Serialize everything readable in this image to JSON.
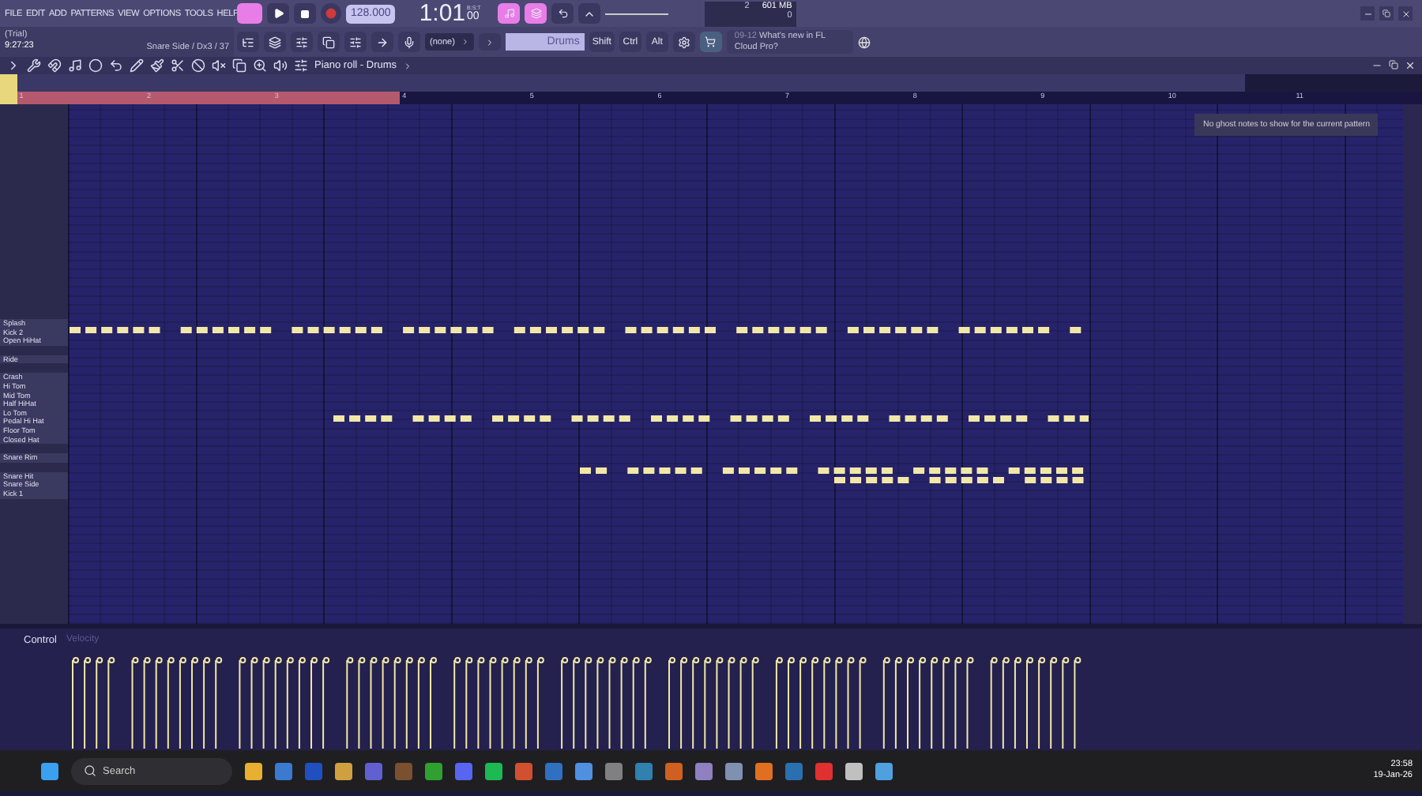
{
  "menu": [
    "FILE",
    "EDIT",
    "ADD",
    "PATTERNS",
    "VIEW",
    "OPTIONS",
    "TOOLS",
    "HELP"
  ],
  "transport": {
    "song_mode": false,
    "tempo": "128.000",
    "time": "1:01",
    "time_small": "00",
    "time_unit": "B:S:T",
    "recording": false
  },
  "monitor": {
    "voices": "2",
    "memory": "601 MB",
    "cpu": "0"
  },
  "hint": {
    "mode": "(Trial)",
    "clock": "9:27:23",
    "status": "Snare Side / Dx3 / 37"
  },
  "target": {
    "value": "(none)"
  },
  "pattern": {
    "value": "Drums"
  },
  "modifiers": [
    {
      "label": "Shift"
    },
    {
      "label": "Ctrl"
    },
    {
      "label": "Alt"
    }
  ],
  "news": {
    "date": "09-12",
    "text": "What's new in FL Cloud Pro?"
  },
  "piano_roll": {
    "title": "Piano roll - Drums",
    "ghost_tooltip": "No ghost notes to show for the current pattern",
    "bars": [
      "1",
      "2",
      "3",
      "4",
      "5",
      "6",
      "7",
      "8",
      "9",
      "10",
      "11"
    ],
    "key_groups": [
      [
        "Splash",
        "Kick 2",
        "Open HiHat"
      ],
      [
        "Ride"
      ],
      [
        "Crash",
        "Hi Tom",
        "Mid Tom",
        "Half HiHat",
        "Lo Tom",
        "Pedal Hi Hat",
        "Floor Tom",
        "Closed Hat"
      ],
      [
        "Snare Rim"
      ],
      [
        "Snare Hit",
        "Snare Side",
        "Kick 1"
      ]
    ],
    "control": "Control",
    "control_param": "Velocity"
  },
  "taskbar": {
    "search": "Search",
    "time": "23:58",
    "date": "19-Jan-26"
  }
}
